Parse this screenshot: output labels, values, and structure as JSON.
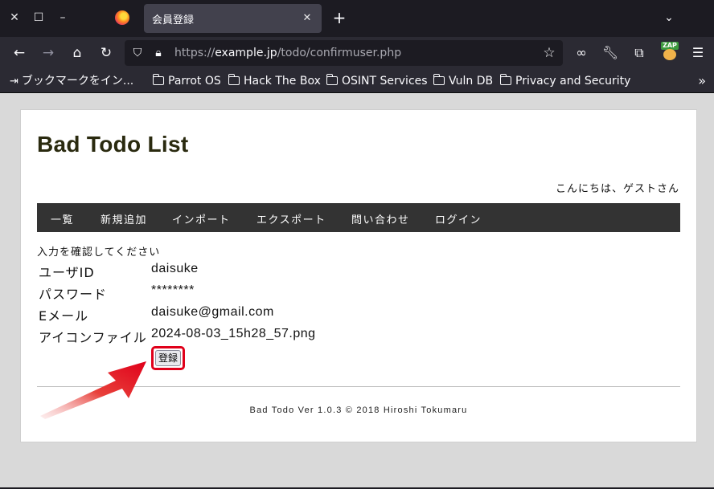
{
  "browser": {
    "tab_title": "会員登録",
    "url_prefix": "https://",
    "url_host": "example.jp",
    "url_path": "/todo/confirmuser.php",
    "zap_badge": "ZAP",
    "bookmarks": [
      "ブックマークをイン...",
      "Parrot OS",
      "Hack The Box",
      "OSINT Services",
      "Vuln DB",
      "Privacy and Security"
    ]
  },
  "site": {
    "title": "Bad Todo List",
    "greeting": "こんにちは、ゲストさん",
    "menu": [
      "一覧",
      "新規追加",
      "インポート",
      "エクスポート",
      "問い合わせ",
      "ログイン"
    ],
    "confirm_message": "入力を確認してください",
    "form": [
      {
        "label": "ユーザID",
        "value": "daisuke"
      },
      {
        "label": "パスワード",
        "value": "********"
      },
      {
        "label": "Eメール",
        "value": "daisuke@gmail.com"
      },
      {
        "label": "アイコンファイル",
        "value": "2024-08-03_15h28_57.png"
      }
    ],
    "submit_label": "登録",
    "footer": "Bad Todo Ver 1.0.3 © 2018 Hiroshi Tokumaru"
  },
  "colors": {
    "chrome_dark": "#1c1b22",
    "chrome_toolbar": "#2b2a33",
    "menu_bg": "#333333",
    "highlight": "#e0001a"
  }
}
